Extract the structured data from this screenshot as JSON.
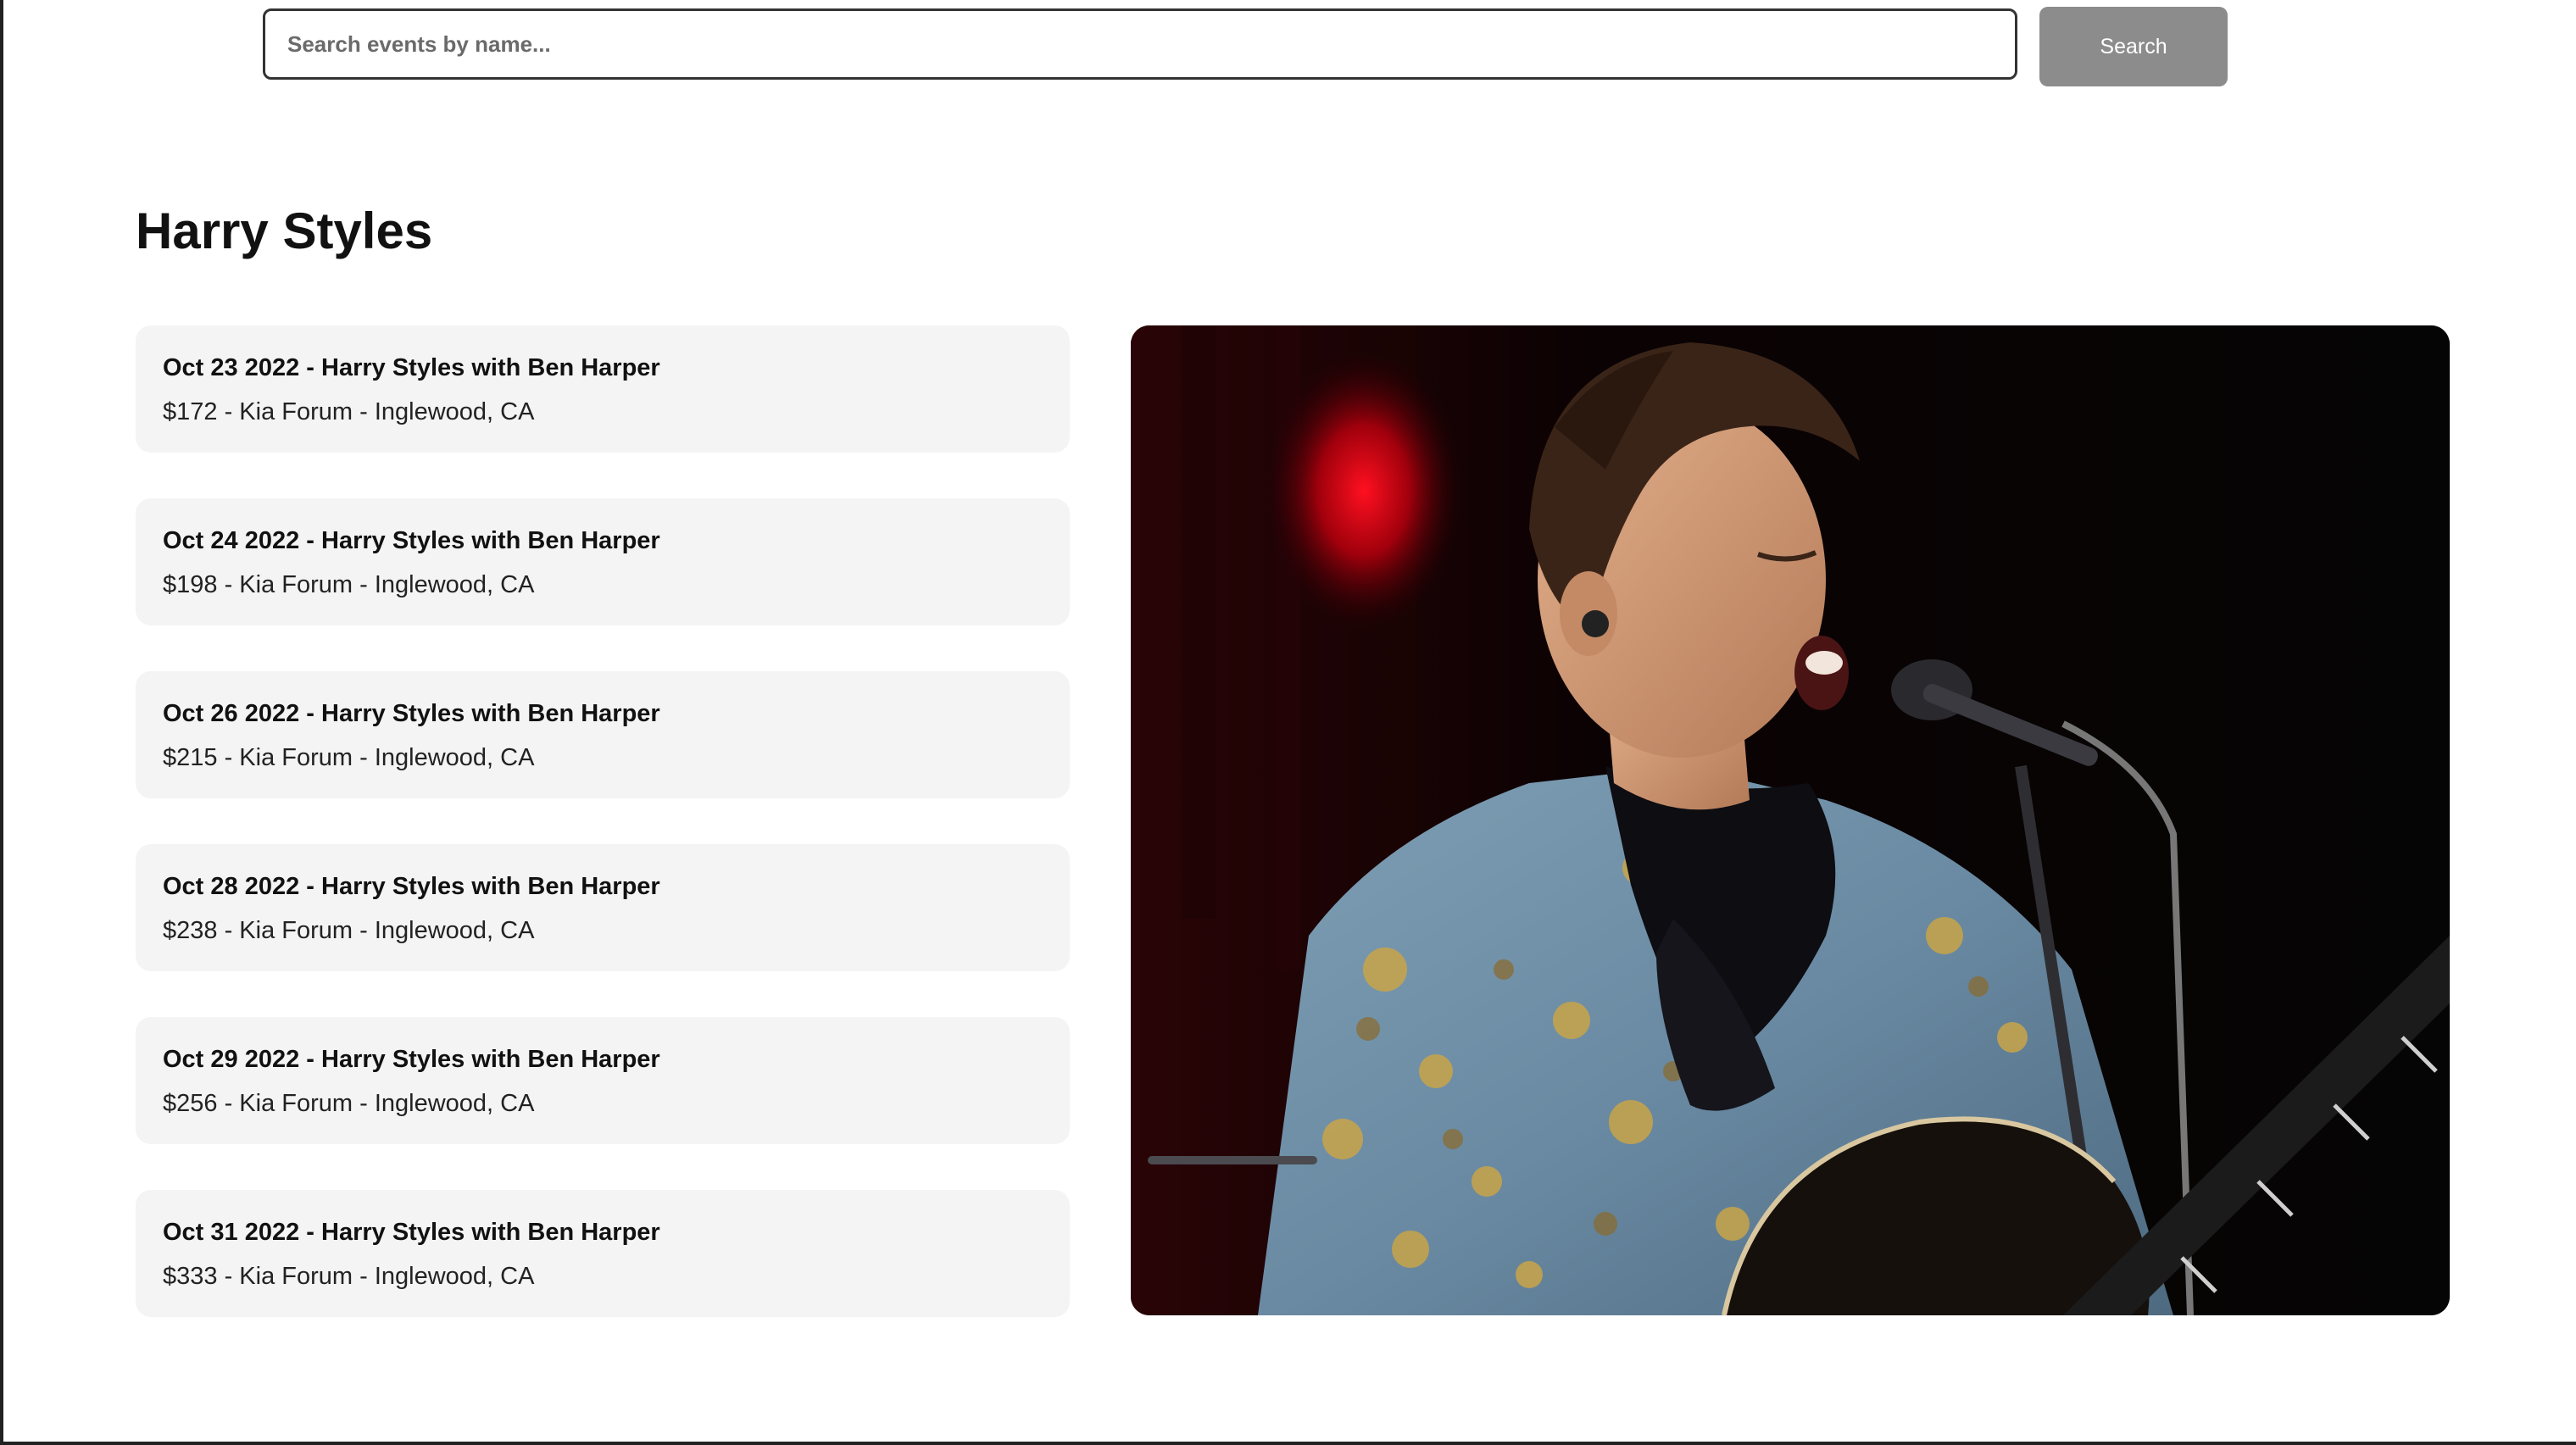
{
  "search": {
    "placeholder": "Search events by name...",
    "value": "",
    "button_label": "Search"
  },
  "artist": {
    "name": "Harry Styles"
  },
  "events": [
    {
      "title": "Oct 23 2022 - Harry Styles with Ben Harper",
      "details": "$172 - Kia Forum - Inglewood, CA"
    },
    {
      "title": "Oct 24 2022 - Harry Styles with Ben Harper",
      "details": "$198 - Kia Forum - Inglewood, CA"
    },
    {
      "title": "Oct 26 2022 - Harry Styles with Ben Harper",
      "details": "$215 - Kia Forum - Inglewood, CA"
    },
    {
      "title": "Oct 28 2022 - Harry Styles with Ben Harper",
      "details": "$238 - Kia Forum - Inglewood, CA"
    },
    {
      "title": "Oct 29 2022 - Harry Styles with Ben Harper",
      "details": "$256 - Kia Forum - Inglewood, CA"
    },
    {
      "title": "Oct 31 2022 - Harry Styles with Ben Harper",
      "details": "$333 - Kia Forum - Inglewood, CA"
    }
  ],
  "colors": {
    "card_background": "#f4f4f4",
    "button_background": "#8c8c8c",
    "photo_background": "#050505"
  }
}
